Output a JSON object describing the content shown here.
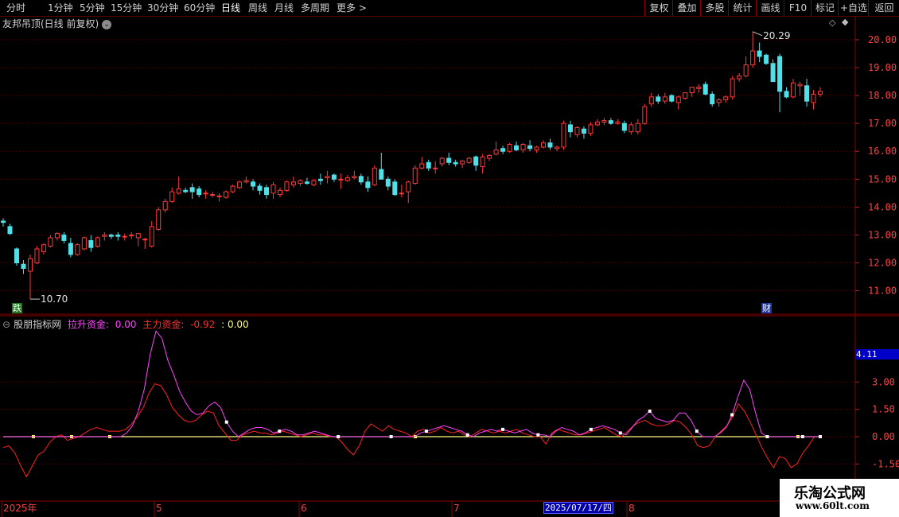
{
  "toolbar": {
    "periods": [
      "分时",
      "1分钟",
      "5分钟",
      "15分钟",
      "30分钟",
      "60分钟",
      "日线",
      "周线",
      "月线",
      "多周期",
      "更多"
    ],
    "active_period": "日线",
    "more_arrow": ">",
    "right_buttons": [
      "复权",
      "叠加",
      "多股",
      "统计",
      "画线",
      "F10",
      "标记",
      "+自选",
      "返回"
    ]
  },
  "main_chart": {
    "title": "友邦吊顶(日线 前复权)",
    "high_label": "20.29",
    "low_label": "10.70",
    "event_badge_left": "跌",
    "event_badge_right": "财",
    "price_ticks": [
      "20.00",
      "19.00",
      "18.00",
      "17.00",
      "16.00",
      "15.00",
      "14.00",
      "13.00",
      "12.00",
      "11.00"
    ],
    "up_color": "#ff3a3a",
    "down_color": "#4fe0e8"
  },
  "indicator": {
    "name": "股朋指标网",
    "line1_name": "拉升资金",
    "line1_value": "0.00",
    "line2_name": "主力资金",
    "line2_value": "-0.92",
    "line3_value": ": 0.00",
    "ticks": [
      "3.00",
      "1.50",
      "0.00",
      "-1.50"
    ],
    "current_value": "4.11"
  },
  "time_axis": {
    "labels": [
      "2025年",
      "5",
      "6",
      "7",
      "2025/07/17/四",
      "8"
    ]
  },
  "watermark": {
    "line1": "乐淘公式网",
    "line2": "www.60lt.com"
  },
  "chart_data": [
    {
      "type": "candlestick",
      "title": "友邦吊顶(日线 前复权)",
      "ylim": [
        10.5,
        20.5
      ],
      "ohlc": [
        [
          13.5,
          13.6,
          13.3,
          13.45
        ],
        [
          13.3,
          13.4,
          13.0,
          13.05
        ],
        [
          12.5,
          12.55,
          11.9,
          12.0
        ],
        [
          11.95,
          12.1,
          11.6,
          11.8
        ],
        [
          11.7,
          12.3,
          10.7,
          12.15
        ],
        [
          12.0,
          12.6,
          11.95,
          12.5
        ],
        [
          12.4,
          12.7,
          12.3,
          12.65
        ],
        [
          12.6,
          13.0,
          12.55,
          12.9
        ],
        [
          12.9,
          13.1,
          12.8,
          13.05
        ],
        [
          13.0,
          13.1,
          12.7,
          12.8
        ],
        [
          12.7,
          12.9,
          12.2,
          12.3
        ],
        [
          12.3,
          12.7,
          12.25,
          12.65
        ],
        [
          12.5,
          12.95,
          12.45,
          12.9
        ],
        [
          12.8,
          13.0,
          12.4,
          12.55
        ],
        [
          12.6,
          12.95,
          12.55,
          12.9
        ],
        [
          12.95,
          13.1,
          12.8,
          13.0
        ],
        [
          13.0,
          13.05,
          12.85,
          12.95
        ],
        [
          13.0,
          13.1,
          12.8,
          12.95
        ],
        [
          12.95,
          13.05,
          12.8,
          12.95
        ],
        [
          13.0,
          13.1,
          12.85,
          13.0
        ],
        [
          12.9,
          13.05,
          12.6,
          13.05
        ],
        [
          12.85,
          12.9,
          12.5,
          12.85
        ],
        [
          12.6,
          13.5,
          12.55,
          13.3
        ],
        [
          13.2,
          14.0,
          13.15,
          13.9
        ],
        [
          13.9,
          14.3,
          13.8,
          14.2
        ],
        [
          14.2,
          14.7,
          14.15,
          14.55
        ],
        [
          14.5,
          15.1,
          14.45,
          14.65
        ],
        [
          14.6,
          14.7,
          14.5,
          14.55
        ],
        [
          14.7,
          14.85,
          14.3,
          14.55
        ],
        [
          14.65,
          14.75,
          14.35,
          14.45
        ],
        [
          14.5,
          14.6,
          14.3,
          14.5
        ],
        [
          14.45,
          14.55,
          14.35,
          14.45
        ],
        [
          14.4,
          14.5,
          14.2,
          14.4
        ],
        [
          14.35,
          14.6,
          14.3,
          14.55
        ],
        [
          14.55,
          14.8,
          14.5,
          14.75
        ],
        [
          14.7,
          14.95,
          14.65,
          14.9
        ],
        [
          14.9,
          15.1,
          14.85,
          14.95
        ],
        [
          14.9,
          15.0,
          14.6,
          14.75
        ],
        [
          14.75,
          14.85,
          14.45,
          14.6
        ],
        [
          14.7,
          14.8,
          14.3,
          14.45
        ],
        [
          14.5,
          14.9,
          14.3,
          14.8
        ],
        [
          14.45,
          14.7,
          14.35,
          14.6
        ],
        [
          14.6,
          14.95,
          14.55,
          14.9
        ],
        [
          14.8,
          15.1,
          14.7,
          14.9
        ],
        [
          14.85,
          15.0,
          14.75,
          14.95
        ],
        [
          14.9,
          15.05,
          14.8,
          14.85
        ],
        [
          14.8,
          15.0,
          14.75,
          14.95
        ],
        [
          15.0,
          15.2,
          14.8,
          14.95
        ],
        [
          15.05,
          15.3,
          14.85,
          15.1
        ],
        [
          15.15,
          15.2,
          14.9,
          15.0
        ],
        [
          15.0,
          15.2,
          14.65,
          15.0
        ],
        [
          14.95,
          15.15,
          14.9,
          15.05
        ],
        [
          15.05,
          15.3,
          15.0,
          15.1
        ],
        [
          15.1,
          15.2,
          14.8,
          14.9
        ],
        [
          14.9,
          15.1,
          14.55,
          14.7
        ],
        [
          14.8,
          15.5,
          14.75,
          15.4
        ],
        [
          15.35,
          15.95,
          15.25,
          15.0
        ],
        [
          15.0,
          15.1,
          14.6,
          14.75
        ],
        [
          14.9,
          15.0,
          14.4,
          14.45
        ],
        [
          14.5,
          14.8,
          14.35,
          14.5
        ],
        [
          14.55,
          14.95,
          14.15,
          14.9
        ],
        [
          14.85,
          15.5,
          14.8,
          15.4
        ],
        [
          15.4,
          15.8,
          15.35,
          15.55
        ],
        [
          15.6,
          15.7,
          15.3,
          15.4
        ],
        [
          15.4,
          15.65,
          15.2,
          15.4
        ],
        [
          15.55,
          15.8,
          15.45,
          15.75
        ],
        [
          15.75,
          15.95,
          15.5,
          15.6
        ],
        [
          15.6,
          15.7,
          15.45,
          15.55
        ],
        [
          15.55,
          15.7,
          15.4,
          15.65
        ],
        [
          15.6,
          15.8,
          15.55,
          15.75
        ],
        [
          15.8,
          15.85,
          15.3,
          15.5
        ],
        [
          15.45,
          15.9,
          15.2,
          15.8
        ],
        [
          15.75,
          15.9,
          15.65,
          15.85
        ],
        [
          15.9,
          16.35,
          15.85,
          16.05
        ],
        [
          16.1,
          16.2,
          15.9,
          16.0
        ],
        [
          16.0,
          16.3,
          15.95,
          16.25
        ],
        [
          16.2,
          16.35,
          16.0,
          16.05
        ],
        [
          16.05,
          16.3,
          15.95,
          16.25
        ],
        [
          16.2,
          16.4,
          16.0,
          16.1
        ],
        [
          16.05,
          16.2,
          15.95,
          16.15
        ],
        [
          16.15,
          16.4,
          16.1,
          16.3
        ],
        [
          16.3,
          16.45,
          16.05,
          16.15
        ],
        [
          16.1,
          16.2,
          16.0,
          16.15
        ],
        [
          16.15,
          17.1,
          16.05,
          17.0
        ],
        [
          16.95,
          17.1,
          16.5,
          16.7
        ],
        [
          16.6,
          16.9,
          16.5,
          16.85
        ],
        [
          16.8,
          16.9,
          16.45,
          16.65
        ],
        [
          16.65,
          17.05,
          16.55,
          16.95
        ],
        [
          16.95,
          17.15,
          16.9,
          17.05
        ],
        [
          17.05,
          17.2,
          16.95,
          17.1
        ],
        [
          17.1,
          17.2,
          16.95,
          17.0
        ],
        [
          17.0,
          17.15,
          16.95,
          17.05
        ],
        [
          17.0,
          17.1,
          16.65,
          16.75
        ],
        [
          16.7,
          17.05,
          16.6,
          16.95
        ],
        [
          16.7,
          17.15,
          16.6,
          17.0
        ],
        [
          17.0,
          17.7,
          16.95,
          17.6
        ],
        [
          17.7,
          18.1,
          17.6,
          17.95
        ],
        [
          17.95,
          18.05,
          17.7,
          17.8
        ],
        [
          17.8,
          18.1,
          17.7,
          17.95
        ],
        [
          18.0,
          18.05,
          17.75,
          17.8
        ],
        [
          17.75,
          18.0,
          17.5,
          17.95
        ],
        [
          17.9,
          18.1,
          17.85,
          18.1
        ],
        [
          18.1,
          18.3,
          17.95,
          18.3
        ],
        [
          18.25,
          18.4,
          18.1,
          18.3
        ],
        [
          18.4,
          18.5,
          18.0,
          18.05
        ],
        [
          18.05,
          18.15,
          17.6,
          17.7
        ],
        [
          17.75,
          17.9,
          17.6,
          17.85
        ],
        [
          17.85,
          18.0,
          17.75,
          17.95
        ],
        [
          17.95,
          18.7,
          17.85,
          18.6
        ],
        [
          18.6,
          18.8,
          18.5,
          18.7
        ],
        [
          18.7,
          19.4,
          18.65,
          19.1
        ],
        [
          19.1,
          20.29,
          19.0,
          19.6
        ],
        [
          19.6,
          19.9,
          19.2,
          19.4
        ],
        [
          19.45,
          19.5,
          19.1,
          19.15
        ],
        [
          19.15,
          19.3,
          18.5,
          18.5
        ],
        [
          19.4,
          19.5,
          17.4,
          18.15
        ],
        [
          18.15,
          18.3,
          17.9,
          17.95
        ],
        [
          17.95,
          18.6,
          17.9,
          18.45
        ],
        [
          18.35,
          18.5,
          18.0,
          18.4
        ],
        [
          18.35,
          18.6,
          17.6,
          17.8
        ],
        [
          17.75,
          18.2,
          17.5,
          18.05
        ],
        [
          18.05,
          18.3,
          17.95,
          18.15
        ]
      ]
    },
    {
      "type": "line",
      "title": "股朋指标网",
      "ylim": [
        -2.4,
        6.7
      ],
      "ticks": [
        3.0,
        1.5,
        0.0,
        -1.5
      ],
      "series": [
        {
          "name": "拉升资金",
          "color": "#ff44ff",
          "values": [
            0,
            0,
            0,
            0,
            0,
            0,
            0,
            0,
            0,
            0,
            0,
            0,
            0,
            0,
            0,
            0,
            0,
            0,
            0,
            0,
            0,
            0.2,
            0.6,
            1.4,
            2.6,
            4.5,
            5.8,
            5.4,
            4.2,
            3.4,
            2.5,
            1.9,
            1.4,
            1.2,
            1.3,
            1.7,
            1.9,
            1.6,
            0.8,
            0.3,
            0,
            0.2,
            0.4,
            0.5,
            0.5,
            0.4,
            0.2,
            0.3,
            0.4,
            0.3,
            0.1,
            0.1,
            0.2,
            0.3,
            0.2,
            0.1,
            0,
            0,
            0,
            0,
            0,
            0,
            0,
            0,
            0,
            0,
            0,
            0,
            0,
            0,
            0,
            0.2,
            0.3,
            0.4,
            0.5,
            0.6,
            0.5,
            0.4,
            0.3,
            0.1,
            0.0,
            0.2,
            0.3,
            0.4,
            0.3,
            0.4,
            0.3,
            0.2,
            0.3,
            0.4,
            0.2,
            0.1,
            0.1,
            0,
            0.3,
            0.5,
            0.4,
            0.3,
            0.1,
            0.2,
            0.4,
            0.5,
            0.6,
            0.5,
            0.4,
            0.2,
            0.1,
            0.5,
            0.9,
            1.1,
            1.4,
            1.0,
            0.9,
            0.8,
            0.9,
            1.3,
            1.3,
            0.9,
            0.3,
            0,
            0,
            0,
            0.2,
            0.5,
            1.2,
            2.2,
            3.1,
            2.6,
            1.3,
            0.2,
            0,
            0,
            0,
            0,
            0,
            0,
            0,
            0,
            0,
            0
          ]
        },
        {
          "name": "主力资金",
          "color": "#ff2020",
          "values": [
            -0.6,
            -0.5,
            -0.9,
            -1.6,
            -2.2,
            -1.6,
            -1.0,
            -0.8,
            -0.3,
            0.0,
            0.1,
            -0.2,
            -0.1,
            0.0,
            0.2,
            0.4,
            0.5,
            0.4,
            0.3,
            0.3,
            0.3,
            0.4,
            0.7,
            1.1,
            1.6,
            2.4,
            2.9,
            2.8,
            2.3,
            1.6,
            1.2,
            0.9,
            0.8,
            0.9,
            1.2,
            1.4,
            1.3,
            0.6,
            0.2,
            -0.2,
            -0.2,
            0.1,
            0.2,
            0.3,
            0.2,
            0.2,
            0.1,
            0.2,
            0.3,
            0.2,
            0.1,
            0.0,
            0.1,
            0.2,
            0.1,
            0.1,
            0.0,
            0.0,
            -0.3,
            -0.7,
            -1.0,
            -0.5,
            0.3,
            0.7,
            0.5,
            0.3,
            0.6,
            0.4,
            0.3,
            0.2,
            0.0,
            0.3,
            0.4,
            0.2,
            0.3,
            0.5,
            0.3,
            0.2,
            0.3,
            0.1,
            0.0,
            0.2,
            0.4,
            0.3,
            0.2,
            0.3,
            0.2,
            0.3,
            0.4,
            0.2,
            0.1,
            0.0,
            0.0,
            -0.4,
            0.2,
            0.4,
            0.3,
            0.2,
            0.1,
            0.1,
            0.2,
            0.3,
            0.4,
            0.5,
            0.3,
            0.1,
            0.0,
            0.3,
            0.6,
            0.8,
            0.9,
            0.7,
            0.6,
            0.6,
            0.7,
            0.9,
            0.8,
            0.5,
            0.1,
            -0.5,
            -0.6,
            -0.5,
            0.0,
            0.3,
            0.6,
            1.1,
            1.8,
            1.4,
            0.8,
            0.1,
            -0.6,
            -1.2,
            -1.7,
            -1.1,
            -1.2,
            -1.7,
            -1.5,
            -0.9,
            -0.5,
            0.0,
            0.0
          ]
        },
        {
          "name": "",
          "color": "#ffff80",
          "values": [
            0,
            0
          ]
        }
      ]
    }
  ]
}
